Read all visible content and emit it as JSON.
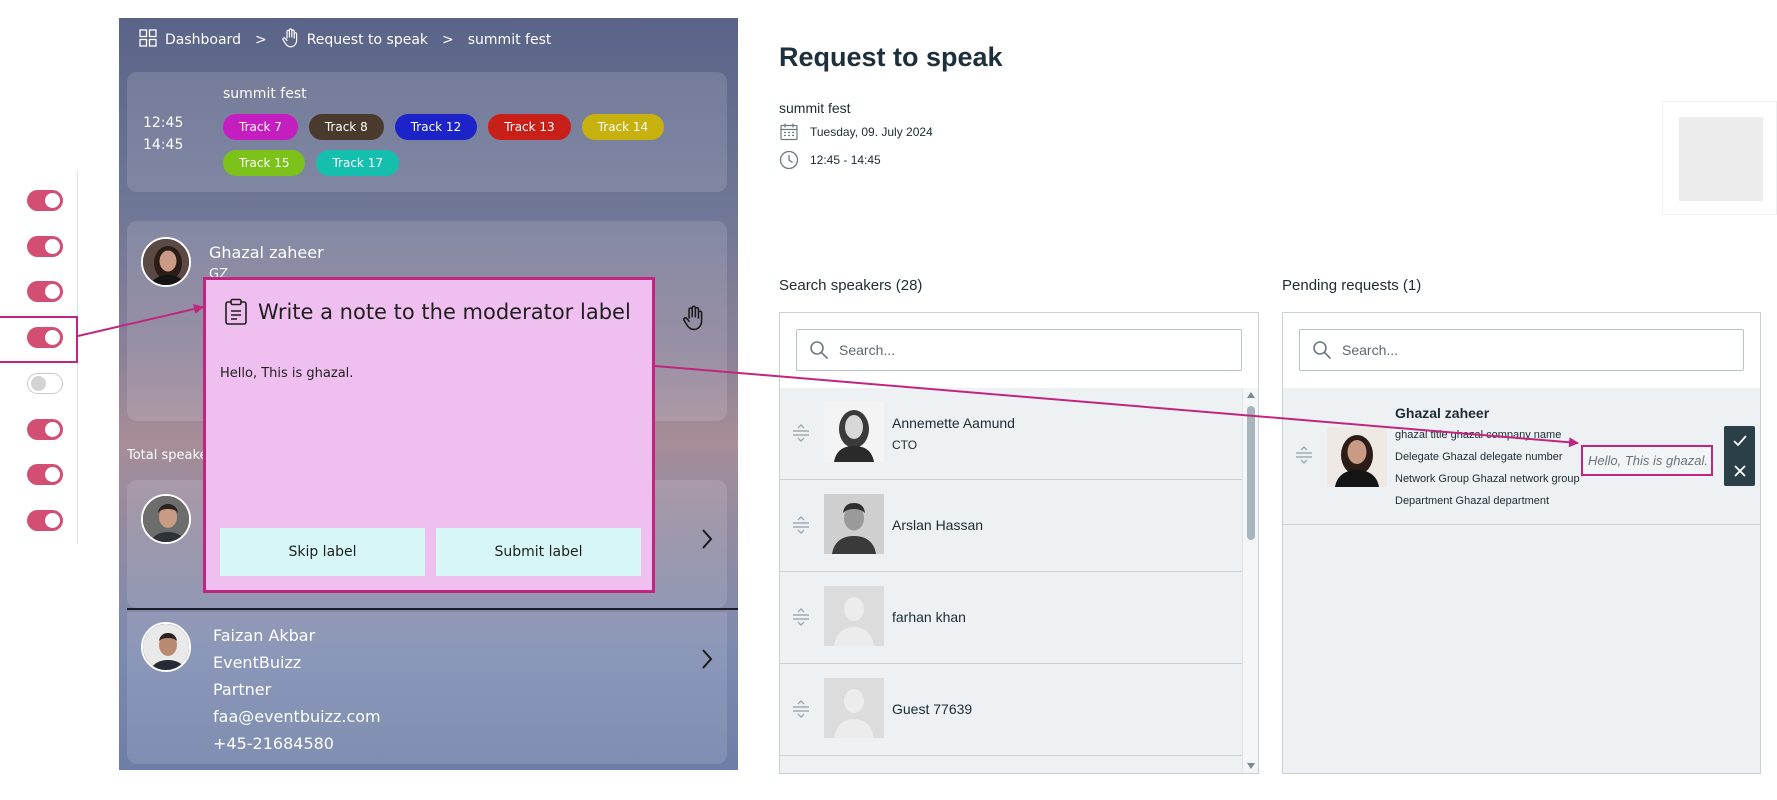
{
  "toggles": [
    {
      "name": "toggle-1",
      "on": true
    },
    {
      "name": "toggle-2",
      "on": true
    },
    {
      "name": "toggle-3",
      "on": true
    },
    {
      "name": "toggle-4",
      "on": true
    },
    {
      "name": "toggle-5",
      "on": false
    },
    {
      "name": "toggle-6",
      "on": true
    },
    {
      "name": "toggle-7",
      "on": true
    },
    {
      "name": "toggle-8",
      "on": true
    }
  ],
  "mobile": {
    "breadcrumb": {
      "dashboard": "Dashboard",
      "request": "Request to speak",
      "event": "summit fest",
      "separator": ">"
    },
    "event": {
      "name": "summit fest",
      "start": "12:45",
      "end": "14:45"
    },
    "tracks": [
      {
        "label": "Track 7",
        "color": "#c41ec0"
      },
      {
        "label": "Track 8",
        "color": "#4a3a2e"
      },
      {
        "label": "Track 12",
        "color": "#1c23c9"
      },
      {
        "label": "Track 13",
        "color": "#c81f18"
      },
      {
        "label": "Track 14",
        "color": "#c7b10e"
      },
      {
        "label": "Track 15",
        "color": "#7cc21a"
      },
      {
        "label": "Track 17",
        "color": "#15bfae"
      }
    ],
    "speaker": {
      "name": "Ghazal zaheer",
      "sub": "GZ"
    },
    "total_label": "Total speakers",
    "people": [
      {
        "name": "Faizan Akbar",
        "company": "EventBuizz",
        "role": "Partner",
        "email": "faa@eventbuizz.com",
        "phone": "+45-21684580"
      }
    ]
  },
  "modal": {
    "title": "Write a note to the moderator label",
    "note": "Hello, This is ghazal.",
    "skip_label": "Skip label",
    "submit_label": "Submit label"
  },
  "page": {
    "title": "Request to speak",
    "event_name": "summit fest",
    "date": "Tuesday, 09. July 2024",
    "time": "12:45 - 14:45"
  },
  "search_panel": {
    "title": "Search speakers (28)",
    "placeholder": "Search...",
    "speakers": [
      {
        "name": "Annemette Aamund",
        "title": "CTO",
        "photo": "woman"
      },
      {
        "name": "Arslan Hassan",
        "title": "",
        "photo": "man"
      },
      {
        "name": "farhan khan",
        "title": "",
        "photo": "placeholder"
      },
      {
        "name": "Guest 77639",
        "title": "",
        "photo": "placeholder"
      }
    ]
  },
  "pending_panel": {
    "title": "Pending requests (1)",
    "placeholder": "Search...",
    "request": {
      "name": "Ghazal zaheer",
      "line1": "ghazal title ghazal company name",
      "line2": "Delegate Ghazal delegate number",
      "line3": "Network Group Ghazal network group",
      "line4": "Department Ghazal department",
      "note": "Hello, This is ghazal."
    }
  },
  "colors": {
    "accent": "#d24e73",
    "highlight": "#c0267f",
    "modal_bg": "#efbff0",
    "button_bg": "#d6f7f6",
    "action_dark": "#2b3f48"
  }
}
